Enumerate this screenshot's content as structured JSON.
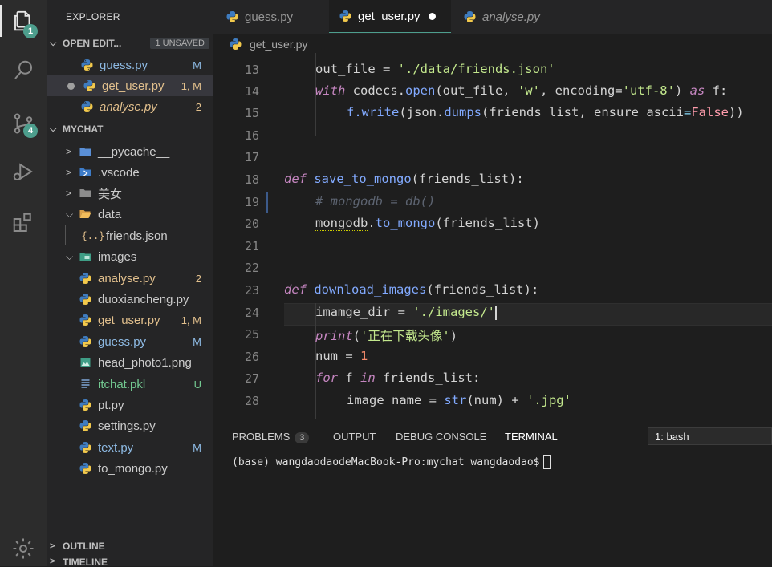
{
  "activity": {
    "explorer_badge": "1",
    "scm_badge": "4"
  },
  "sidebar": {
    "title": "EXPLORER",
    "open_editors": {
      "label": "OPEN EDIT...",
      "unsaved": "1 UNSAVED",
      "items": [
        {
          "name": "guess.py",
          "badge": "M"
        },
        {
          "name": "get_user.py",
          "badge": "1, M"
        },
        {
          "name": "analyse.py",
          "badge": "2"
        }
      ]
    },
    "project": {
      "label": "MYCHAT",
      "items": [
        {
          "name": "__pycache__",
          "badge": ""
        },
        {
          "name": ".vscode",
          "badge": ""
        },
        {
          "name": "美女",
          "badge": ""
        },
        {
          "name": "data",
          "badge": ""
        },
        {
          "name": "friends.json",
          "badge": ""
        },
        {
          "name": "images",
          "badge": ""
        },
        {
          "name": "analyse.py",
          "badge": "2"
        },
        {
          "name": "duoxiancheng.py",
          "badge": ""
        },
        {
          "name": "get_user.py",
          "badge": "1, M"
        },
        {
          "name": "guess.py",
          "badge": "M"
        },
        {
          "name": "head_photo1.png",
          "badge": ""
        },
        {
          "name": "itchat.pkl",
          "badge": "U"
        },
        {
          "name": "pt.py",
          "badge": ""
        },
        {
          "name": "settings.py",
          "badge": ""
        },
        {
          "name": "text.py",
          "badge": "M"
        },
        {
          "name": "to_mongo.py",
          "badge": ""
        }
      ]
    },
    "outline": "OUTLINE",
    "timeline": "TIMELINE"
  },
  "tabs": [
    {
      "label": "guess.py"
    },
    {
      "label": "get_user.py"
    },
    {
      "label": "analyse.py"
    }
  ],
  "breadcrumb": "get_user.py",
  "editor": {
    "line_numbers": [
      "13",
      "14",
      "15",
      "16",
      "17",
      "18",
      "19",
      "20",
      "21",
      "22",
      "23",
      "24",
      "25",
      "26",
      "27",
      "28"
    ],
    "lines": {
      "l13": {
        "a": "out_file = ",
        "b": "'./data/friends.json'"
      },
      "l14": {
        "a": "with",
        "b": " codecs.",
        "c": "open",
        "d": "(out_file, ",
        "e": "'w'",
        "f": ", encoding=",
        "g": "'utf-8'",
        "h": ") ",
        "i": "as",
        "j": " f:"
      },
      "l15": {
        "a": "f.",
        "b": "write",
        "c": "(json.",
        "d": "dumps",
        "e": "(friends_list, ensure_ascii",
        "f": "=",
        "g": "False",
        "h": "))"
      },
      "l18": {
        "a": "def",
        "b": " ",
        "c": "save_to_mongo",
        "d": "(friends_list):"
      },
      "l19": {
        "a": "# mongodb = db()"
      },
      "l20": {
        "a": "mongodb",
        "b": ".",
        "c": "to_mongo",
        "d": "(friends_list)"
      },
      "l23": {
        "a": "def",
        "b": " ",
        "c": "download_images",
        "d": "(friends_list):"
      },
      "l24": {
        "a": "imamge_dir = ",
        "b": "'./images/'"
      },
      "l25": {
        "a": "print",
        "b": "(",
        "c": "'正在下载头像'",
        "d": ")"
      },
      "l26": {
        "a": "num = ",
        "b": "1"
      },
      "l27": {
        "a": "for",
        "b": " f ",
        "c": "in",
        "d": " friends_list:"
      },
      "l28": {
        "a": "image_name = ",
        "b": "str",
        "c": "(num) + ",
        "d": "'.jpg'"
      }
    }
  },
  "panel": {
    "tabs": [
      {
        "label": "PROBLEMS",
        "count": "3"
      },
      {
        "label": "OUTPUT"
      },
      {
        "label": "DEBUG CONSOLE"
      },
      {
        "label": "TERMINAL"
      }
    ],
    "terminal_select": "1: bash",
    "prompt": "(base) wangdaodaodeMacBook-Pro:mychat wangdaodao$"
  },
  "colors": {
    "accent": "#4d9e8d",
    "modified": "#e2c08d",
    "error": "#f48771",
    "untracked": "#73c991"
  }
}
